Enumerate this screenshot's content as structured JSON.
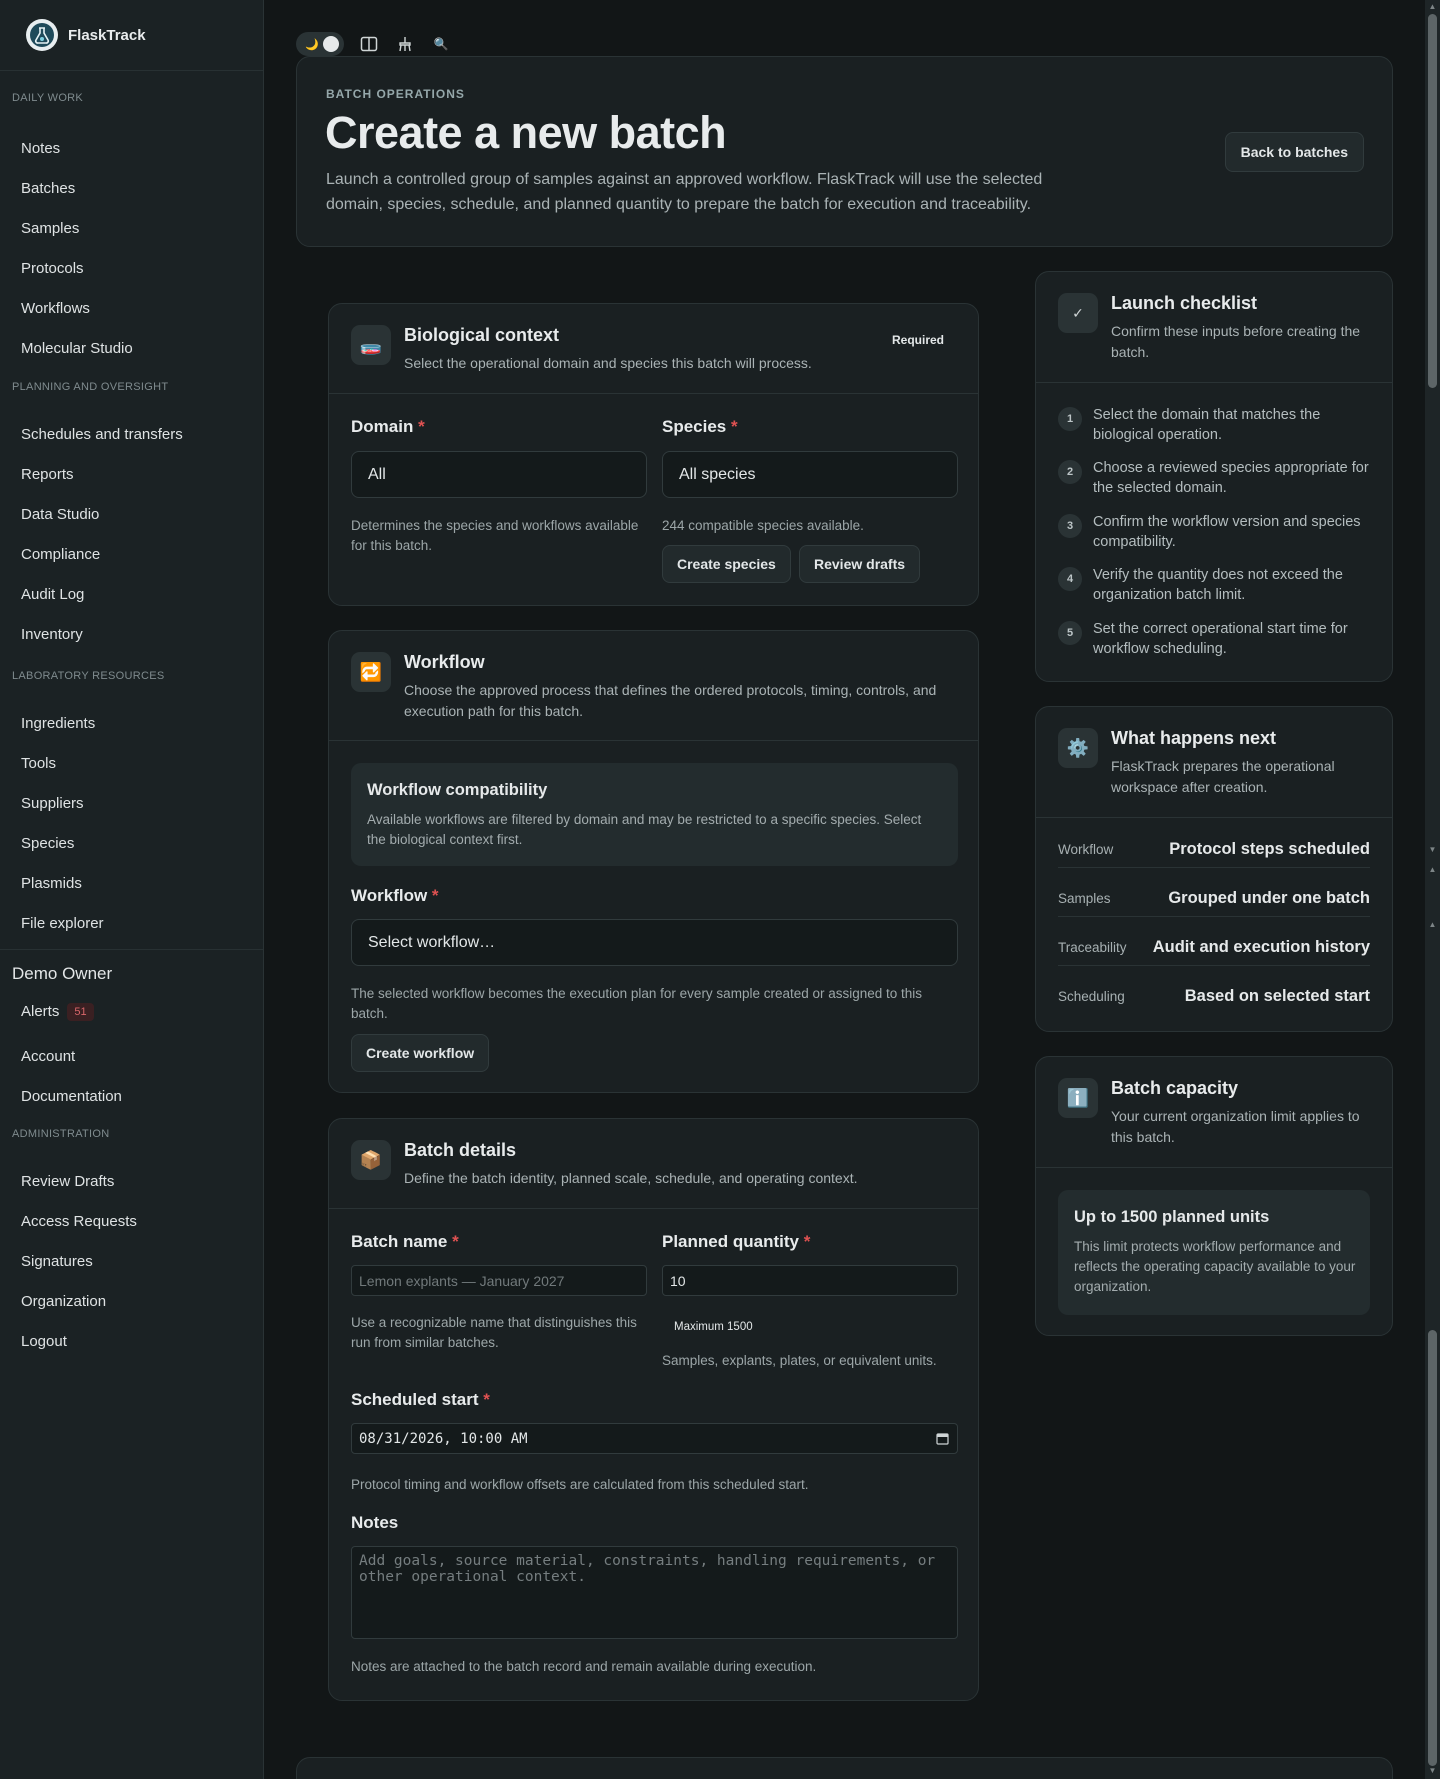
{
  "app": {
    "name": "FlaskTrack"
  },
  "sidebar": {
    "sections": [
      {
        "heading": "DAILY WORK",
        "items": [
          "Notes",
          "Batches",
          "Samples",
          "Protocols",
          "Workflows",
          "Molecular Studio"
        ]
      },
      {
        "heading": "PLANNING AND OVERSIGHT",
        "items": [
          "Schedules and transfers",
          "Reports",
          "Data Studio",
          "Compliance",
          "Audit Log",
          "Inventory"
        ]
      },
      {
        "heading": "LABORATORY RESOURCES",
        "items": [
          "Ingredients",
          "Tools",
          "Suppliers",
          "Species",
          "Plasmids",
          "File explorer"
        ]
      }
    ],
    "user": {
      "name": "Demo Owner",
      "alerts_label": "Alerts",
      "alerts_count": "51",
      "account": "Account",
      "documentation": "Documentation"
    },
    "admin": {
      "heading": "ADMINISTRATION",
      "items": [
        "Review Drafts",
        "Access Requests",
        "Signatures",
        "Organization",
        "Logout"
      ]
    }
  },
  "toolbar": {
    "moon": "🌙",
    "panel_icon": "panel-icon",
    "tool_icon": "broom-icon",
    "search": "🔍"
  },
  "header": {
    "eyebrow": "BATCH OPERATIONS",
    "title": "Create a new batch",
    "description": "Launch a controlled group of samples against an approved workflow. FlaskTrack will use the selected domain, species, schedule, and planned quantity to prepare the batch for execution and traceability.",
    "back_button": "Back to batches"
  },
  "bio": {
    "icon": "🧫",
    "title": "Biological context",
    "subtitle": "Select the operational domain and species this batch will process.",
    "badge": "Required",
    "domain_label": "Domain",
    "domain_value": "All",
    "domain_help": "Determines the species and workflows available for this batch.",
    "species_label": "Species",
    "species_value": "All species",
    "species_help": "244 compatible species available.",
    "create_species": "Create species",
    "review_drafts": "Review drafts"
  },
  "workflow": {
    "icon": "🔁",
    "title": "Workflow",
    "subtitle": "Choose the approved process that defines the ordered protocols, timing, controls, and execution path for this batch.",
    "compat_title": "Workflow compatibility",
    "compat_text": "Available workflows are filtered by domain and may be restricted to a specific species. Select the biological context first.",
    "label": "Workflow",
    "placeholder": "Select workflow…",
    "help": "The selected workflow becomes the execution plan for every sample created or assigned to this batch.",
    "create_button": "Create workflow"
  },
  "details": {
    "icon": "📦",
    "title": "Batch details",
    "subtitle": "Define the batch identity, planned scale, schedule, and operating context.",
    "name_label": "Batch name",
    "name_placeholder": "Lemon explants — January 2027",
    "name_help": "Use a recognizable name that distinguishes this run from similar batches.",
    "qty_label": "Planned quantity",
    "qty_value": "10",
    "qty_max": "Maximum 1500",
    "qty_help": "Samples, explants, plates, or equivalent units.",
    "start_label": "Scheduled start",
    "start_value": "08/31/2026, 10:00 AM",
    "start_help": "Protocol timing and workflow offsets are calculated from this scheduled start.",
    "notes_label": "Notes",
    "notes_placeholder": "Add goals, source material, constraints, handling requirements, or other operational context.",
    "notes_help": "Notes are attached to the batch record and remain available during execution."
  },
  "checklist": {
    "icon": "✓",
    "title": "Launch checklist",
    "subtitle": "Confirm these inputs before creating the batch.",
    "items": [
      "Select the domain that matches the biological operation.",
      "Choose a reviewed species appropriate for the selected domain.",
      "Confirm the workflow version and species compatibility.",
      "Verify the quantity does not exceed the organization batch limit.",
      "Set the correct operational start time for workflow scheduling."
    ]
  },
  "next": {
    "icon": "⚙️",
    "title": "What happens next",
    "subtitle": "FlaskTrack prepares the operational workspace after creation.",
    "rows": [
      {
        "k": "Workflow",
        "v": "Protocol steps scheduled"
      },
      {
        "k": "Samples",
        "v": "Grouped under one batch"
      },
      {
        "k": "Traceability",
        "v": "Audit and execution history"
      },
      {
        "k": "Scheduling",
        "v": "Based on selected start"
      }
    ]
  },
  "capacity": {
    "icon": "ℹ️",
    "title": "Batch capacity",
    "subtitle": "Your current organization limit applies to this batch.",
    "box_title": "Up to 1500 planned units",
    "box_text": "This limit protects workflow performance and reflects the operating capacity available to your organization."
  },
  "colors": {
    "accent_required": "#e05252",
    "background": "#121617",
    "card": "#1a2022"
  }
}
